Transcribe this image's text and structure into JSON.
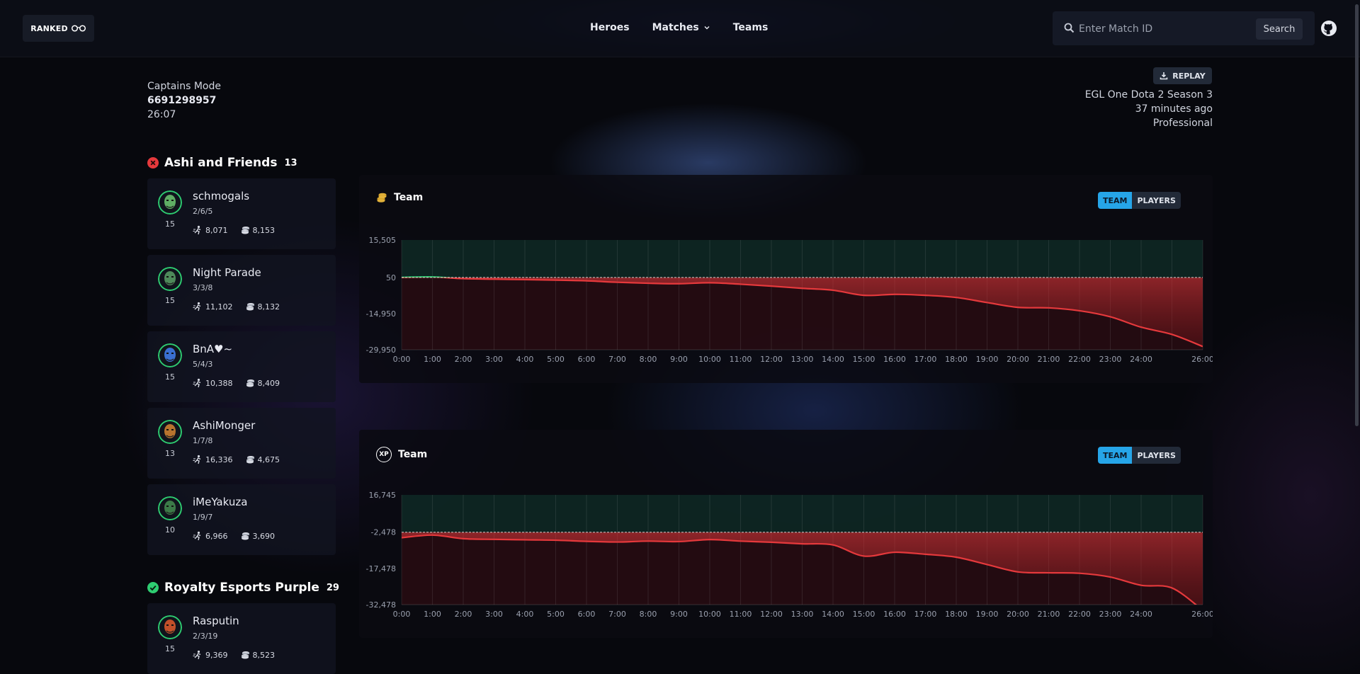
{
  "header": {
    "logo_text": "RANKED",
    "nav": {
      "heroes": "Heroes",
      "matches": "Matches",
      "teams": "Teams"
    },
    "search": {
      "placeholder": "Enter Match ID",
      "button": "Search"
    }
  },
  "match": {
    "mode": "Captains Mode",
    "id": "6691298957",
    "duration": "26:07",
    "replay_label": "REPLAY",
    "league": "EGL One Dota 2 Season 3",
    "time_ago": "37 minutes ago",
    "tier": "Professional"
  },
  "teams": [
    {
      "name": "Ashi and Friends",
      "score": "13",
      "result": "loss",
      "players": [
        {
          "name": "schmogals",
          "kda": "2/6/5",
          "level": "15",
          "networth": "8,071",
          "gold": "8,153",
          "color": "#5fae64"
        },
        {
          "name": "Night Parade",
          "kda": "3/3/8",
          "level": "15",
          "networth": "11,102",
          "gold": "8,132",
          "color": "#4e8a5a"
        },
        {
          "name": "BnA♥~",
          "kda": "5/4/3",
          "level": "15",
          "networth": "10,388",
          "gold": "8,409",
          "color": "#3a6fd0"
        },
        {
          "name": "AshiMonger",
          "kda": "1/7/8",
          "level": "13",
          "networth": "16,336",
          "gold": "4,675",
          "color": "#b8742e"
        },
        {
          "name": "iMeYakuza",
          "kda": "1/9/7",
          "level": "10",
          "networth": "6,966",
          "gold": "3,690",
          "color": "#3c7a48"
        }
      ]
    },
    {
      "name": "Royalty Esports Purple",
      "score": "29",
      "result": "win",
      "players": [
        {
          "name": "Rasputin",
          "kda": "2/3/19",
          "level": "15",
          "networth": "9,369",
          "gold": "8,523",
          "color": "#c2502a"
        }
      ]
    }
  ],
  "graphs": [
    {
      "title": "Team",
      "icon": "gold-coins-icon",
      "toggle": {
        "team": "TEAM",
        "players": "PLAYERS"
      },
      "chart_data": {
        "type": "area",
        "yticks": [
          "15,505",
          "50",
          "-14,950",
          "-29,950"
        ],
        "ylim": [
          -29950,
          15505
        ],
        "xticks": [
          "0:00",
          "1:00",
          "2:00",
          "3:00",
          "4:00",
          "5:00",
          "6:00",
          "7:00",
          "8:00",
          "9:00",
          "10:00",
          "11:00",
          "12:00",
          "13:00",
          "14:00",
          "15:00",
          "16:00",
          "17:00",
          "18:00",
          "19:00",
          "20:00",
          "21:00",
          "22:00",
          "23:00",
          "24:00",
          "26:00"
        ],
        "x": [
          0,
          1,
          2,
          3,
          4,
          5,
          6,
          7,
          8,
          9,
          10,
          11,
          12,
          13,
          14,
          15,
          16,
          17,
          18,
          19,
          20,
          21,
          22,
          23,
          24,
          25,
          26
        ],
        "y": [
          0,
          200,
          -500,
          -700,
          -900,
          -1100,
          -1400,
          -2000,
          -2400,
          -2600,
          -2200,
          -2800,
          -3600,
          -4500,
          -5300,
          -7400,
          -7000,
          -7400,
          -8300,
          -10400,
          -12400,
          -12600,
          -13800,
          -16300,
          -20600,
          -23600,
          -28600
        ],
        "positive_color": "#2ecc71",
        "negative_color": "#e5393c"
      }
    },
    {
      "title": "Team",
      "icon": "xp-icon",
      "icon_text": "XP",
      "toggle": {
        "team": "TEAM",
        "players": "PLAYERS"
      },
      "chart_data": {
        "type": "area",
        "yticks": [
          "16,745",
          "-2,478",
          "-17,478",
          "-32,478"
        ],
        "ylim": [
          -32478,
          16745
        ],
        "xticks": [
          "0:00",
          "1:00",
          "2:00",
          "3:00",
          "4:00",
          "5:00",
          "6:00",
          "7:00",
          "8:00",
          "9:00",
          "10:00",
          "11:00",
          "12:00",
          "13:00",
          "14:00",
          "15:00",
          "16:00",
          "17:00",
          "18:00",
          "19:00",
          "20:00",
          "21:00",
          "22:00",
          "23:00",
          "24:00",
          "26:00"
        ],
        "x": [
          0,
          1,
          2,
          3,
          4,
          5,
          6,
          7,
          8,
          9,
          10,
          11,
          12,
          13,
          14,
          15,
          16,
          17,
          18,
          19,
          20,
          21,
          22,
          23,
          24,
          25,
          26
        ],
        "y": [
          -2478,
          -1300,
          -2900,
          -3200,
          -3400,
          -3600,
          -4100,
          -4400,
          -4000,
          -4200,
          -3300,
          -4000,
          -4500,
          -5200,
          -5700,
          -10700,
          -9000,
          -9900,
          -11200,
          -14500,
          -17800,
          -18200,
          -18400,
          -20100,
          -23800,
          -25000,
          -35000
        ],
        "positive_color": "#2ecc71",
        "negative_color": "#e5393c"
      }
    }
  ]
}
